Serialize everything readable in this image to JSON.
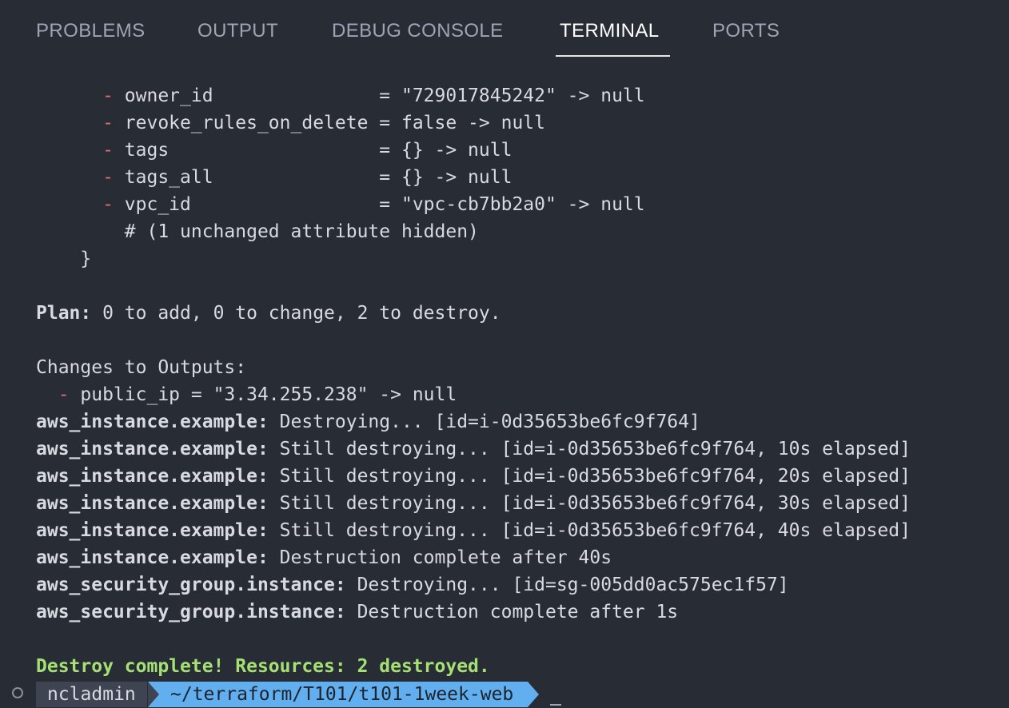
{
  "tabs": [
    {
      "label": "PROBLEMS"
    },
    {
      "label": "OUTPUT"
    },
    {
      "label": "DEBUG CONSOLE"
    },
    {
      "label": "TERMINAL",
      "active": true
    },
    {
      "label": "PORTS"
    }
  ],
  "terminal": {
    "attributes": [
      {
        "indent": "      ",
        "minus": "- ",
        "text": "owner_id               = \"729017845242\" -> null"
      },
      {
        "indent": "      ",
        "minus": "- ",
        "text": "revoke_rules_on_delete = false -> null"
      },
      {
        "indent": "      ",
        "minus": "- ",
        "text": "tags                   = {} -> null"
      },
      {
        "indent": "      ",
        "minus": "- ",
        "text": "tags_all               = {} -> null"
      },
      {
        "indent": "      ",
        "minus": "- ",
        "text": "vpc_id                 = \"vpc-cb7bb2a0\" -> null"
      }
    ],
    "hidden_note": "        # (1 unchanged attribute hidden)",
    "close_brace": "    }",
    "plan_label": "Plan:",
    "plan_text": " 0 to add, 0 to change, 2 to destroy.",
    "outputs_heading": "Changes to Outputs:",
    "output_change_indent": "  ",
    "output_change_minus": "- ",
    "output_change_text": "public_ip = \"3.34.255.238\" -> null",
    "log": [
      {
        "resource": "aws_instance.example:",
        "message": " Destroying... [id=i-0d35653be6fc9f764]"
      },
      {
        "resource": "aws_instance.example:",
        "message": " Still destroying... [id=i-0d35653be6fc9f764, 10s elapsed]"
      },
      {
        "resource": "aws_instance.example:",
        "message": " Still destroying... [id=i-0d35653be6fc9f764, 20s elapsed]"
      },
      {
        "resource": "aws_instance.example:",
        "message": " Still destroying... [id=i-0d35653be6fc9f764, 30s elapsed]"
      },
      {
        "resource": "aws_instance.example:",
        "message": " Still destroying... [id=i-0d35653be6fc9f764, 40s elapsed]"
      },
      {
        "resource": "aws_instance.example:",
        "message": " Destruction complete after 40s"
      },
      {
        "resource": "aws_security_group.instance:",
        "message": " Destroying... [id=sg-005dd0ac575ec1f57]"
      },
      {
        "resource": "aws_security_group.instance:",
        "message": " Destruction complete after 1s"
      }
    ],
    "success_message": "Destroy complete! Resources: 2 destroyed."
  },
  "prompt": {
    "user": "ncladmin",
    "path": "~/terraform/T101/t101-1week-web"
  },
  "colors": {
    "background": "#282c34",
    "removed": "#e06c75",
    "success": "#a5e075",
    "prompt_user_bg": "#3e4451",
    "prompt_path_bg": "#61afef"
  }
}
